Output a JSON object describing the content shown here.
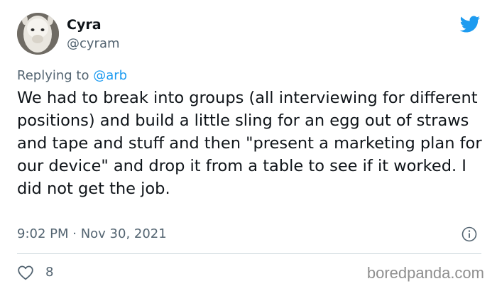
{
  "author": {
    "display_name": "Cyra",
    "handle": "@cyram"
  },
  "reply": {
    "prefix": "Replying to ",
    "mention": "@arb"
  },
  "tweet": {
    "text": "We had to break into groups (all interviewing for different positions) and build a little sling for an egg out of straws and tape and stuff and then \"present a marketing plan for our device\" and drop it from a table to see if it worked. I did not get the job.",
    "timestamp": "9:02 PM · Nov 30, 2021"
  },
  "actions": {
    "like_count": "8"
  },
  "watermark": "boredpanda.com",
  "icons": {
    "brand": "twitter-bird-icon",
    "info": "info-icon",
    "like": "heart-icon"
  },
  "colors": {
    "brand_blue": "#1d9bf0",
    "secondary_text": "#536471",
    "primary_text": "#0f1419",
    "divider": "#cfd9de"
  }
}
